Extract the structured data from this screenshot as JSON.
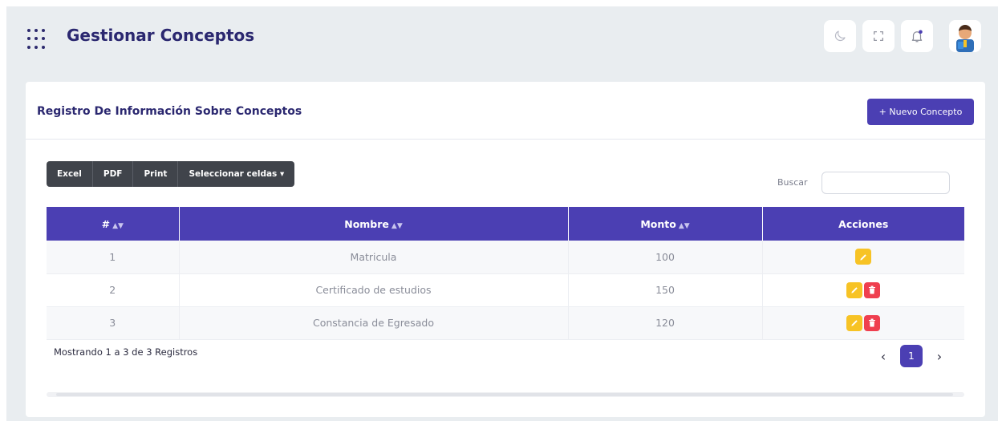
{
  "header": {
    "title": "Gestionar Conceptos"
  },
  "card": {
    "title": "Registro De Información Sobre Conceptos",
    "new_button": "+ Nuevo Concepto"
  },
  "toolbar": {
    "excel": "Excel",
    "pdf": "PDF",
    "print": "Print",
    "select_cells": "Seleccionar celdas ▾"
  },
  "search": {
    "label": "Buscar",
    "value": "",
    "placeholder": ""
  },
  "table": {
    "columns": [
      "#",
      "Nombre",
      "Monto",
      "Acciones"
    ],
    "rows": [
      {
        "num": "1",
        "nombre": "Matricula",
        "monto": "100"
      },
      {
        "num": "2",
        "nombre": "Certificado de estudios",
        "monto": "150"
      },
      {
        "num": "3",
        "nombre": "Constancia de Egresado",
        "monto": "120"
      }
    ]
  },
  "footer": {
    "info": "Mostrando 1 a 3 de 3 Registros",
    "current_page": "1",
    "prev": "‹",
    "next": "›"
  },
  "colors": {
    "primary": "#4b3fb3",
    "title": "#2b2870",
    "edit": "#f7c325",
    "delete": "#ef3f4f"
  }
}
